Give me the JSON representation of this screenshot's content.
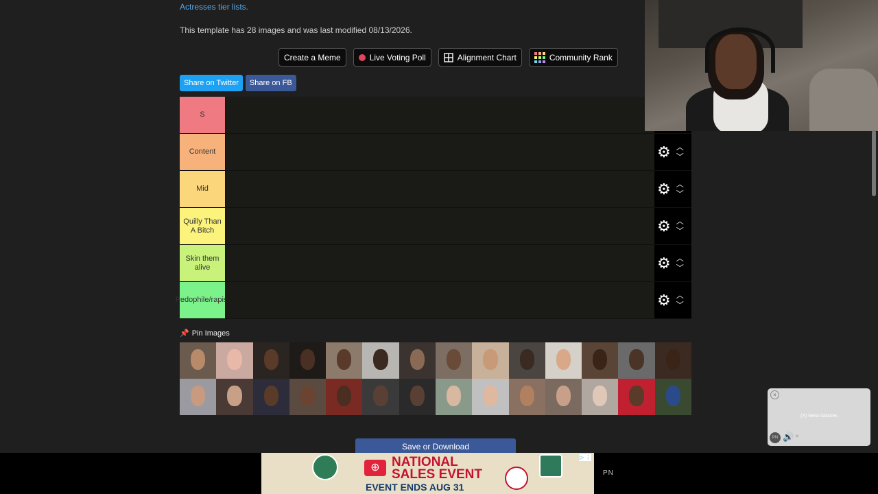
{
  "header": {
    "link_text": "Actresses tier lists.",
    "meta_text": "This template has 28 images and was last modified 08/13/2026."
  },
  "actions": [
    {
      "label": "Create a Meme",
      "icon": ""
    },
    {
      "label": "Live Voting Poll",
      "icon": "live-dot-icon"
    },
    {
      "label": "Alignment Chart",
      "icon": "grid-icon"
    },
    {
      "label": "Community Rank",
      "icon": "community-grid-icon"
    }
  ],
  "share": {
    "twitter_label": "Share on Twitter",
    "fb_label": "Share on FB"
  },
  "tiers": [
    {
      "label": "S",
      "color": "#f07a82"
    },
    {
      "label": "Content",
      "color": "#f7b27c"
    },
    {
      "label": "Mid",
      "color": "#fcd67a"
    },
    {
      "label": "Quilly Than A Bitch",
      "color": "#fbf37c"
    },
    {
      "label": "Skin them alive",
      "color": "#c8f27a"
    },
    {
      "label": "Pedophile/rapist",
      "color": "#7bf28a"
    }
  ],
  "pin_images": {
    "label": "Pin Images",
    "icon": "pin-icon",
    "count": 28
  },
  "save_button": "Save or Download",
  "ad": {
    "title_line1": "NATIONAL",
    "title_line2": "SALES EVENT",
    "subtitle": "EVENT ENDS AUG 31",
    "brand_icon": "toyota-logo",
    "info": "▷ ⋮"
  },
  "footer_tag": "PN",
  "mini_player": {
    "caption": "(X) Meta Glasses",
    "badge": "PN"
  }
}
